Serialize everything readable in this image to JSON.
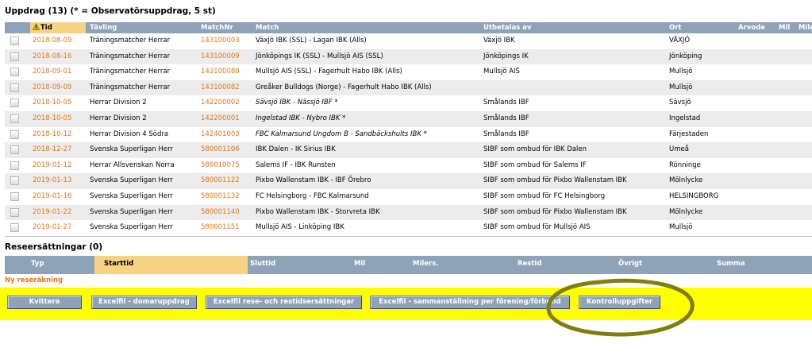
{
  "assignments": {
    "title": "Uppdrag (13) (* = Observatörsuppdrag, 5 st)",
    "sort_icon": "warning-triangle-icon",
    "columns": {
      "time": "Tid",
      "competition": "Tävling",
      "match_nr": "MatchNr",
      "match": "Match",
      "paid_by": "Utbetalas av",
      "place": "Ort",
      "fee": "Arvode",
      "mil": "Mil",
      "milers": "Miler"
    },
    "rows": [
      {
        "date": "2018-08-09",
        "competition": "Träningsmatcher Herrar",
        "match_nr": "143100003",
        "match": "Växjö IBK (SSL) - Lagan IBK (Alls)",
        "paid_by": "Växjö IBK",
        "place": "VÄXJÖ"
      },
      {
        "date": "2018-08-16",
        "competition": "Träningsmatcher Herrar",
        "match_nr": "143100009",
        "match": "Jönköpings IK (SSL) - Mullsjö AIS (SSL)",
        "paid_by": "Jönköpings IK",
        "place": "Jönköping"
      },
      {
        "date": "2018-09-01",
        "competition": "Träningsmatcher Herrar",
        "match_nr": "143100080",
        "match": "Mullsjö AIS (SSL) - Fagerhult Habo IBK (Alls)",
        "paid_by": "Mullsjö AIS",
        "place": "Mullsjö"
      },
      {
        "date": "2018-09-09",
        "competition": "Träningsmatcher Herrar",
        "match_nr": "143100082",
        "match": "Greåker Bulldogs (Norge) - Fagerhult Habo IBK (Alls)",
        "paid_by": "",
        "place": "Mullsjö"
      },
      {
        "date": "2018-10-05",
        "competition": "Herrar Division 2",
        "match_nr": "142200002",
        "match": "Sävsjö IBK - Nässjö IBF *",
        "paid_by": "Smålands IBF",
        "place": "Sävsjö"
      },
      {
        "date": "2018-10-05",
        "competition": "Herrar Division 2",
        "match_nr": "142200001",
        "match": "Ingelstad IBK - Nybro IBK *",
        "paid_by": "Smålands IBF",
        "place": "Ingelstad"
      },
      {
        "date": "2018-10-12",
        "competition": "Herrar Division 4 Södra",
        "match_nr": "142401003",
        "match": "FBC Kalmarsund Ungdom B - Sandbäckshults IBK *",
        "paid_by": "Smålands IBF",
        "place": "Färjestaden"
      },
      {
        "date": "2018-12-27",
        "competition": "Svenska Superligan Herr",
        "match_nr": "580001106",
        "match": "IBK Dalen - IK Sirius IBK",
        "paid_by": "SIBF som ombud för IBK Dalen",
        "place": "Umeå"
      },
      {
        "date": "2019-01-12",
        "competition": "Herrar Allsvenskan Norra",
        "match_nr": "580010075",
        "match": "Salems IF - IBK Runsten",
        "paid_by": "SIBF som ombud för Salems IF",
        "place": "Rönninge"
      },
      {
        "date": "2019-01-13",
        "competition": "Svenska Superligan Herr",
        "match_nr": "580001122",
        "match": "Pixbo Wallenstam IBK - IBF Örebro",
        "paid_by": "SIBF som ombud för Pixbo Wallenstam IBK",
        "place": "Mölnlycke"
      },
      {
        "date": "2019-01-16",
        "competition": "Svenska Superligan Herr",
        "match_nr": "580001132",
        "match": "FC Helsingborg - FBC Kalmarsund",
        "paid_by": "SIBF som ombud för FC Helsingborg",
        "place": "HELSINGBORG"
      },
      {
        "date": "2019-01-22",
        "competition": "Svenska Superligan Herr",
        "match_nr": "580001140",
        "match": "Pixbo Wallenstam IBK - Storvreta IBK",
        "paid_by": "SIBF som ombud för Pixbo Wallenstam IBK",
        "place": "Mölnlycke"
      },
      {
        "date": "2019-01-27",
        "competition": "Svenska Superligan Herr",
        "match_nr": "580001151",
        "match": "Mullsjö AIS - Linköping IBK",
        "paid_by": "SIBF som ombud för Mullsjö AIS",
        "place": "Mullsjö"
      }
    ]
  },
  "expenses": {
    "title": "Reseersättningar (0)",
    "columns": {
      "type": "Typ",
      "start_time": "Starttid",
      "end_time": "Sluttid",
      "mil": "Mil",
      "milers": "Milers.",
      "travel_time": "Restid",
      "other": "Övrigt",
      "sum": "Summa"
    },
    "new_link": "Ny reseräkning"
  },
  "buttons": {
    "receipt": "Kvittera",
    "excel_assignments": "Excelfil - domaruppdrag",
    "excel_travel": "Excelfil rese- och restidsersättningar",
    "excel_summary": "Excelfil - sammanställning per förening/förbund",
    "control": "Kontrolluppgifter"
  },
  "colors": {
    "header_bg": "#8ea2b8",
    "sorted_header_bg": "#f7d483",
    "accent_orange": "#e07818",
    "button_bar_bg": "#ffff00",
    "highlight_circle": "#7f7f10"
  }
}
